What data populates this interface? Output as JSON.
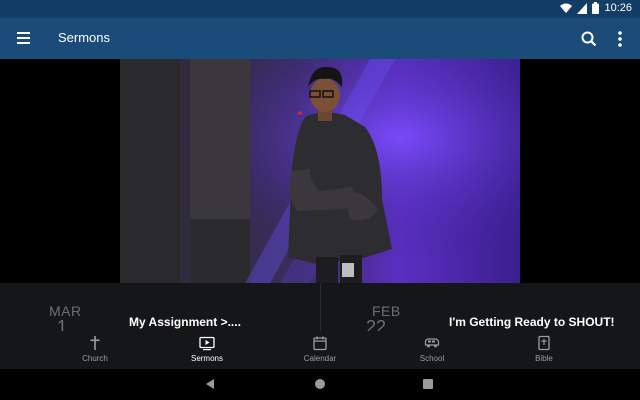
{
  "status_bar": {
    "time": "10:26"
  },
  "app_bar": {
    "title": "Sermons"
  },
  "carousel": {
    "items": [
      {
        "month": "MAR",
        "day": "1",
        "title": "My Assignment >...."
      },
      {
        "month": "FEB",
        "day": "22",
        "title": "I'm Getting Ready to SHOUT!"
      }
    ]
  },
  "bottom_nav": {
    "active": "Sermons",
    "items": [
      {
        "label": "Church",
        "icon": "cross-icon"
      },
      {
        "label": "Sermons",
        "icon": "video-play-icon"
      },
      {
        "label": "Calendar",
        "icon": "calendar-icon"
      },
      {
        "label": "School",
        "icon": "bus-icon"
      },
      {
        "label": "Bible",
        "icon": "bible-icon"
      }
    ]
  },
  "colors": {
    "status_bar": "#143d66",
    "app_bar": "#1b4b78",
    "nav_bg": "#151618",
    "active": "#ffffff",
    "inactive": "#9a9da2"
  }
}
